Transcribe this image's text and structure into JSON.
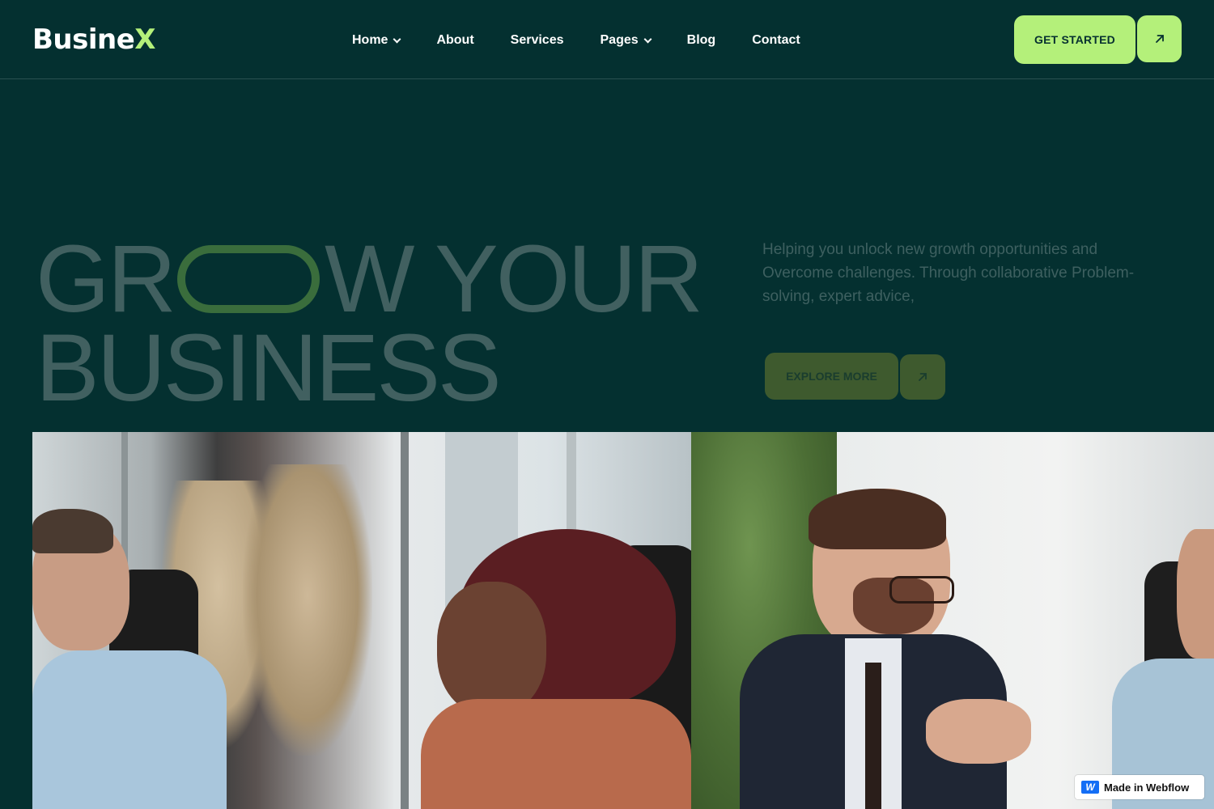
{
  "brand": {
    "logo_text": "Busine",
    "logo_accent": "X",
    "accent_color": "#b4f07a",
    "background_color": "#043030"
  },
  "nav": {
    "items": [
      {
        "label": "Home",
        "has_dropdown": true
      },
      {
        "label": "About",
        "has_dropdown": false
      },
      {
        "label": "Services",
        "has_dropdown": false
      },
      {
        "label": "Pages",
        "has_dropdown": true
      },
      {
        "label": "Blog",
        "has_dropdown": false
      },
      {
        "label": "Contact",
        "has_dropdown": false
      }
    ],
    "cta_label": "GET STARTED",
    "cta_icon": "arrow-up-right-icon"
  },
  "hero": {
    "title_line1_start": "GR",
    "title_line1_end": "W YOUR",
    "title_line2": "BUSINESS",
    "description": "Helping you unlock new growth opportunities and Overcome challenges. Through collaborative Problem-solving, expert advice,",
    "explore_label": "EXPLORE MORE",
    "explore_icon": "arrow-up-right-icon"
  },
  "gallery": {
    "images": [
      {
        "name": "team-meeting-photo-left"
      },
      {
        "name": "team-meeting-photo-right"
      }
    ]
  },
  "badge": {
    "label": "Made in Webflow",
    "icon": "webflow-logo-icon"
  }
}
